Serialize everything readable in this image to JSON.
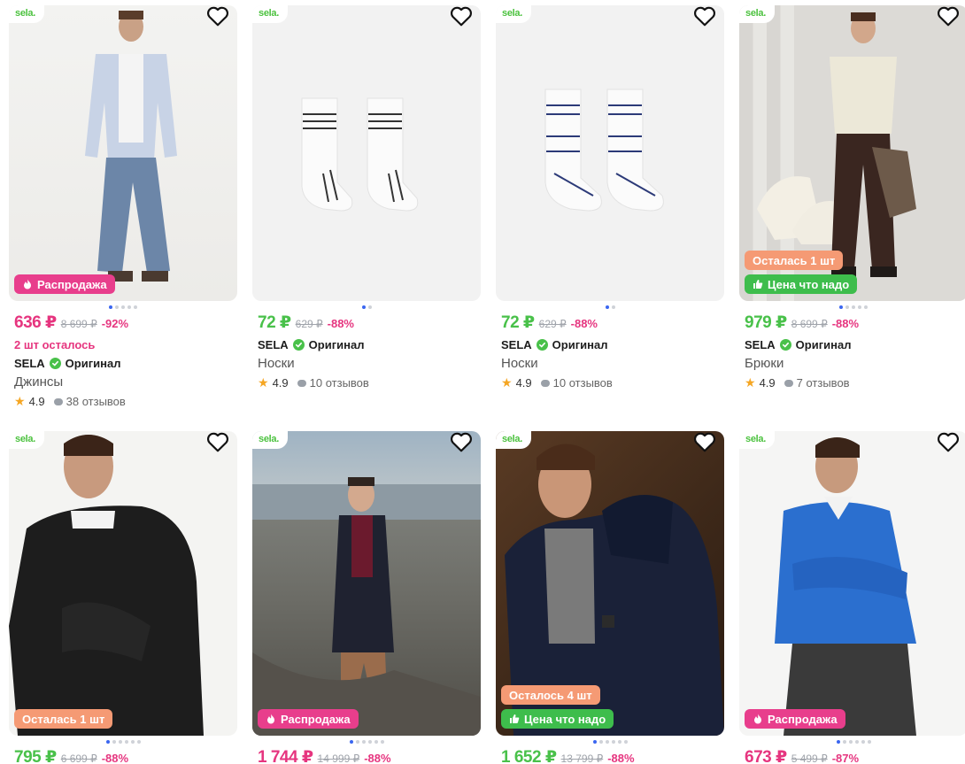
{
  "products": [
    {
      "logo": "sela.",
      "badges": [
        {
          "type": "sale",
          "label": "Распродажа"
        }
      ],
      "price": "636 ₽",
      "price_color": "pink",
      "old_price": "8 699 ₽",
      "discount": "-92%",
      "stock_note": "2 шт осталось",
      "brand": "SELA",
      "original_label": "Оригинал",
      "category": "Джинсы",
      "rating": "4.9",
      "reviews": "38 отзывов",
      "dots_active": 0,
      "dots_total": 5
    },
    {
      "logo": "sela.",
      "badges": [],
      "price": "72 ₽",
      "price_color": "green",
      "old_price": "629 ₽",
      "discount": "-88%",
      "brand": "SELA",
      "original_label": "Оригинал",
      "category": "Носки",
      "rating": "4.9",
      "reviews": "10 отзывов",
      "dots_active": 0,
      "dots_total": 2
    },
    {
      "logo": "sela.",
      "badges": [],
      "price": "72 ₽",
      "price_color": "green",
      "old_price": "629 ₽",
      "discount": "-88%",
      "brand": "SELA",
      "original_label": "Оригинал",
      "category": "Носки",
      "rating": "4.9",
      "reviews": "10 отзывов",
      "dots_active": 0,
      "dots_total": 2
    },
    {
      "logo": "sela.",
      "badges": [
        {
          "type": "left",
          "label": "Осталась 1 шт"
        },
        {
          "type": "nice",
          "label": "Цена что надо"
        }
      ],
      "price": "979 ₽",
      "price_color": "green",
      "old_price": "8 699 ₽",
      "discount": "-88%",
      "brand": "SELA",
      "original_label": "Оригинал",
      "category": "Брюки",
      "rating": "4.9",
      "reviews": "7 отзывов",
      "dots_active": 0,
      "dots_total": 5
    },
    {
      "logo": "sela.",
      "badges": [
        {
          "type": "left",
          "label": "Осталась 1 шт"
        }
      ],
      "price": "795 ₽",
      "price_color": "green",
      "old_price": "6 699 ₽",
      "discount": "-88%",
      "dots_active": 0,
      "dots_total": 6
    },
    {
      "logo": "sela.",
      "badges": [
        {
          "type": "sale",
          "label": "Распродажа"
        }
      ],
      "price": "1 744 ₽",
      "price_color": "pink",
      "old_price": "14 999 ₽",
      "discount": "-88%",
      "dots_active": 0,
      "dots_total": 6
    },
    {
      "logo": "sela.",
      "badges": [
        {
          "type": "left",
          "label": "Осталось 4 шт"
        },
        {
          "type": "nice",
          "label": "Цена что надо"
        }
      ],
      "price": "1 652 ₽",
      "price_color": "green",
      "old_price": "13 799 ₽",
      "discount": "-88%",
      "dots_active": 0,
      "dots_total": 6
    },
    {
      "logo": "sela.",
      "badges": [
        {
          "type": "sale",
          "label": "Распродажа"
        }
      ],
      "price": "673 ₽",
      "price_color": "pink",
      "old_price": "5 499 ₽",
      "discount": "-87%",
      "dots_active": 0,
      "dots_total": 6
    }
  ],
  "colors": {
    "sale_badge": "#e83e8c",
    "nice_price_badge": "#3ebd4c",
    "stock_badge": "#f59a74",
    "price_pink": "#e6357f",
    "price_green": "#49c14a",
    "dot_active": "#3a66f0"
  },
  "icons": {
    "favorite": "heart-outline-icon",
    "sale": "flame-icon",
    "nice_price": "thumbs-up-icon",
    "original": "check-circle-icon",
    "rating": "star-icon",
    "reviews": "speech-bubble-icon"
  }
}
